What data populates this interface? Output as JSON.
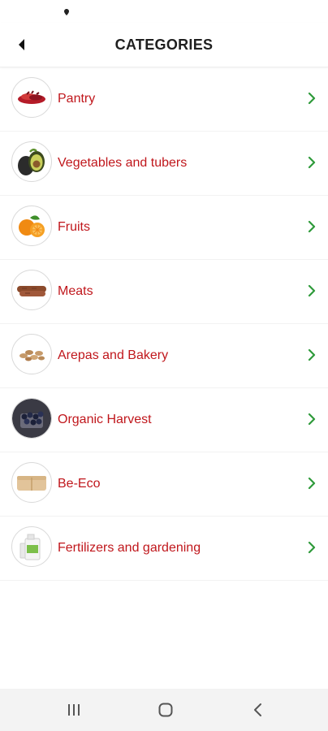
{
  "header": {
    "title": "CATEGORIES"
  },
  "categories": [
    {
      "label": "Pantry",
      "icon": "spices-icon"
    },
    {
      "label": "Vegetables and tubers",
      "icon": "avocado-icon"
    },
    {
      "label": "Fruits",
      "icon": "oranges-icon"
    },
    {
      "label": "Meats",
      "icon": "sausage-icon"
    },
    {
      "label": "Arepas and Bakery",
      "icon": "nuts-icon"
    },
    {
      "label": "Organic Harvest",
      "icon": "berries-icon"
    },
    {
      "label": "Be-Eco",
      "icon": "container-icon"
    },
    {
      "label": "Fertilizers and gardening",
      "icon": "bottle-icon"
    }
  ],
  "colors": {
    "label": "#c0171c",
    "chevron": "#2e9a3a",
    "navbar": "#f3f3f3"
  }
}
